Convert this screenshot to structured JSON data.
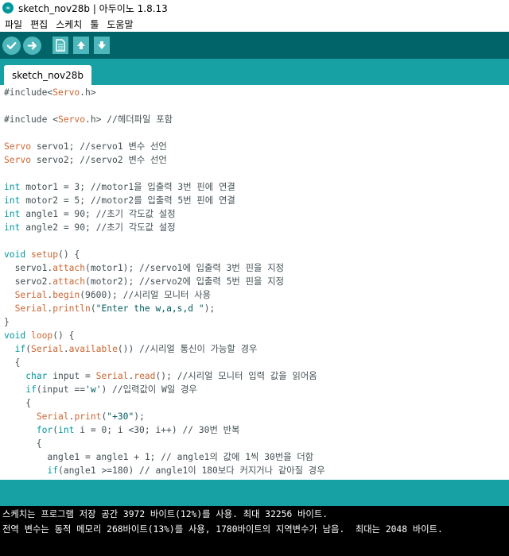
{
  "window": {
    "title": "sketch_nov28b | 아두이노 1.8.13",
    "icon_text": "∞"
  },
  "menu": [
    "파일",
    "편집",
    "스케치",
    "툴",
    "도움말"
  ],
  "toolbar": {
    "verify_icon": "check-icon",
    "upload_icon": "arrow-right-icon",
    "new_icon": "new-file-icon",
    "open_icon": "arrow-up-icon",
    "save_icon": "arrow-down-icon"
  },
  "tabs": [
    {
      "label": "sketch_nov28b"
    }
  ],
  "colors": {
    "toolbar": "#006468",
    "tabbar": "#17a1a5",
    "button": "#4db7bb",
    "keyword": "#00979c",
    "type": "#cc6633",
    "console": "#000000"
  },
  "code": [
    "#include<Servo.h>",
    "",
    "#include <Servo.h> //헤더파일 포함",
    "",
    "Servo servo1; //servo1 변수 선언",
    "Servo servo2; //servo2 변수 선언",
    "",
    "int motor1 = 3; //motor1을 입출력 3번 핀에 연결",
    "int motor2 = 5; //motor2를 입출력 5번 핀에 연결",
    "int angle1 = 90; //초기 각도값 설정",
    "int angle2 = 90; //초기 각도값 설정",
    "",
    "void setup() {",
    "  servo1.attach(motor1); //servo1에 입출력 3번 핀을 지정",
    "  servo2.attach(motor2); //servo2에 입출력 5번 핀을 지정",
    "  Serial.begin(9600); //시리얼 모니터 사용",
    "  Serial.println(\"Enter the w,a,s,d \");",
    "}",
    "void loop() {",
    "  if(Serial.available()) //시리얼 통신이 가능할 경우",
    "  {",
    "    char input = Serial.read(); //시리얼 모니터 입력 값을 읽어옴",
    "    if(input =='w') //입력값이 W일 경우",
    "    {",
    "      Serial.print(\"+30\");",
    "      for(int i = 0; i <30; i++) // 30번 반복",
    "      {",
    "        angle1 = angle1 + 1; // angle1의 값에 1씩 30번을 더함",
    "        if(angle1 >=180) // angle1이 180보다 커지거나 같아질 경우"
  ],
  "console": [
    "스케치는 프로그램 저장 공간 3972 바이트(12%)를 사용. 최대 32256 바이트.",
    "전역 변수는 동적 메모리 268바이트(13%)를 사용, 1780바이트의 지역변수가 남음.  최대는 2048 바이트."
  ]
}
